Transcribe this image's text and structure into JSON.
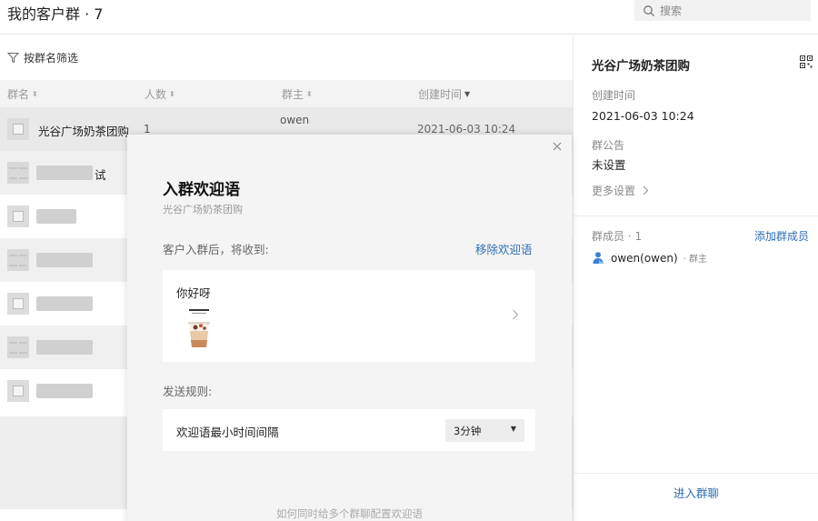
{
  "header": {
    "title": "我的客户群 · 7",
    "search_placeholder": "搜索"
  },
  "filter": {
    "label": "按群名筛选"
  },
  "table": {
    "columns": [
      {
        "label": "群名"
      },
      {
        "label": "人数"
      },
      {
        "label": "群主"
      },
      {
        "label": "创建时间"
      }
    ],
    "rows": [
      {
        "name": "光谷广场奶茶团购",
        "count": "1",
        "owner": "owen",
        "time": "2021-06-03 10:24"
      },
      {
        "name_suffix": "试"
      }
    ]
  },
  "side": {
    "title": "光谷广场奶茶团购",
    "created_label": "创建时间",
    "created_value": "2021-06-03 10:24",
    "notice_label": "群公告",
    "notice_value": "未设置",
    "more_settings": "更多设置",
    "members_label": "群成员 · 1",
    "add_member": "添加群成员",
    "member_name": "owen(owen)",
    "member_role": "· 群主",
    "enter_chat": "进入群聊"
  },
  "modal": {
    "title": "入群欢迎语",
    "subtitle": "光谷广场奶茶团购",
    "prompt": "客户入群后，将收到:",
    "remove_label": "移除欢迎语",
    "welcome_text": "你好呀",
    "rules_label": "发送规则:",
    "rule_label": "欢迎语最小时间间隔",
    "rule_value": "3分钟",
    "bottom_link": "如何同时给多个群聊配置欢迎语"
  },
  "colors": {
    "accent": "#2f6eb5",
    "modal_bg": "#f4f4f4",
    "selected_row": "#e9e9e9"
  }
}
